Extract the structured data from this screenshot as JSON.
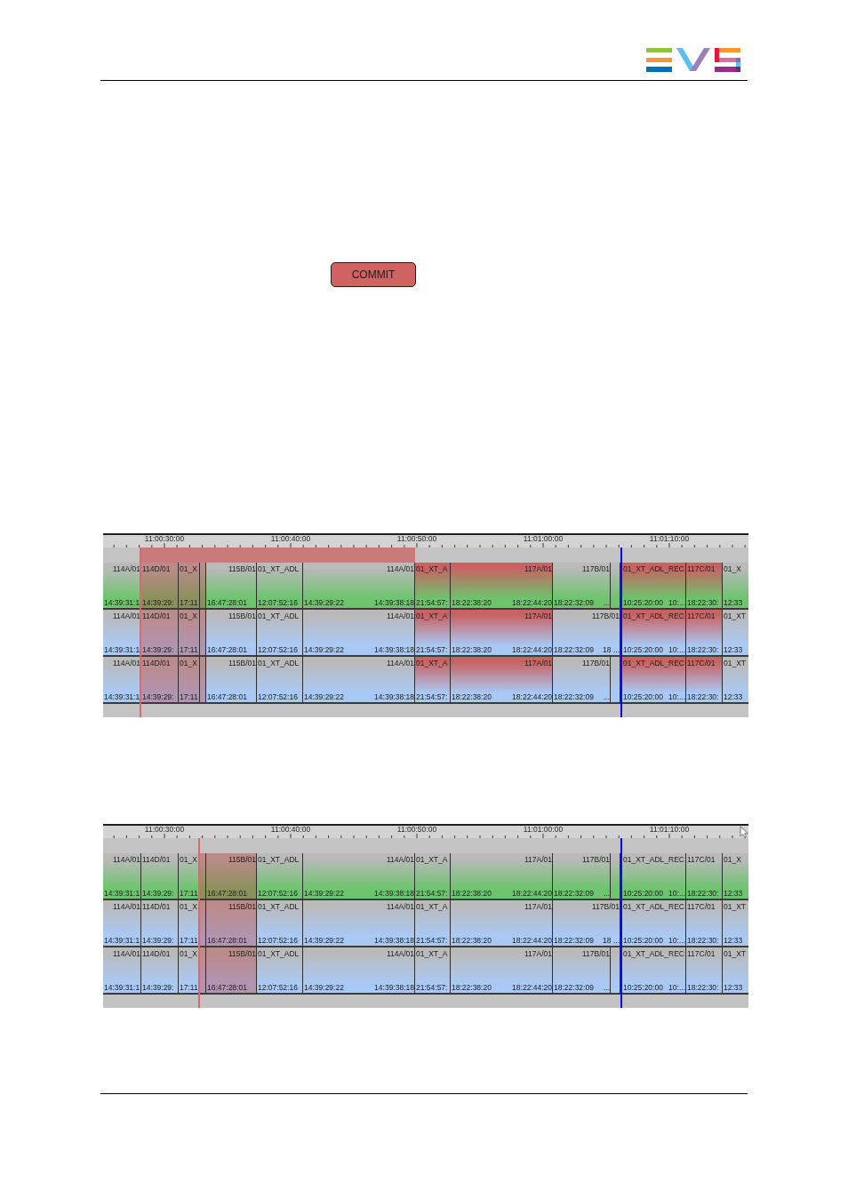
{
  "commit_button": {
    "label": "COMMIT"
  },
  "timelines": [
    {
      "ruler": [
        "11:00:30:00",
        "11:00:40:00",
        "11:00:50:00",
        "11:01:00:00",
        "11:01:10:00"
      ],
      "range_band": true,
      "cursor": false,
      "tracks": [
        {
          "color": "#6cc46c",
          "clips": [
            {
              "label": "114A/01",
              "start": "14:39:31:1",
              "selected": false,
              "marked": false
            },
            {
              "label": "114D/01",
              "start": "14:39:29:",
              "selected": false,
              "marked": true
            },
            {
              "label": "01_X",
              "start": "17:11",
              "selected": false,
              "marked": true
            },
            {
              "selected": false,
              "marked": true
            },
            {
              "label": "115B/01",
              "start": "16:47:28:01",
              "selected": false,
              "marked": false
            },
            {
              "label": "01_XT_ADL",
              "start": "12:07:52:16",
              "selected": false,
              "marked": false
            },
            {
              "label": "114A/01",
              "start": "14:39:29:22",
              "end": "14:39:38:18",
              "selected": false,
              "marked": false
            },
            {
              "label": "01_XT_A",
              "start": "21:54:57:",
              "selected": true,
              "marked": false
            },
            {
              "label": "117A/01",
              "start": "18:22:38:20",
              "end": "18:22:44:20",
              "selected": true,
              "marked": false
            },
            {
              "label": "117B/01",
              "start": "18:22:32:09",
              "end": "...",
              "selected": false,
              "marked": false
            },
            {
              "selected": false,
              "marked": false
            },
            {
              "label": "01_XT_ADL_REC",
              "start": "10:25:20:00",
              "end": "10:...",
              "selected": true,
              "marked": false
            },
            {
              "label": "117C/01",
              "start": "18:22:30:",
              "selected": true,
              "marked": false
            },
            {
              "label": "01_X",
              "start": "12:33",
              "selected": false,
              "marked": false
            }
          ]
        },
        {
          "color": "#a9c9f5",
          "clips": [
            {
              "label": "114A/01",
              "start": "14:39:31:1",
              "selected": false,
              "marked": false
            },
            {
              "label": "114D/01",
              "start": "14:39:29:",
              "selected": false,
              "marked": true
            },
            {
              "label": "01_X",
              "start": "17:11",
              "selected": false,
              "marked": true
            },
            {
              "selected": false,
              "marked": true
            },
            {
              "label": "115B/01",
              "start": "16:47:28:01",
              "selected": false,
              "marked": false
            },
            {
              "label": "01_XT_ADL",
              "start": "12:07:52:16",
              "selected": false,
              "marked": false
            },
            {
              "label": "114A/01",
              "start": "14:39:29:22",
              "end": "14:39:38:18",
              "selected": false,
              "marked": false
            },
            {
              "label": "01_XT_A",
              "start": "21:54:57:",
              "selected": true,
              "marked": false
            },
            {
              "label": "117A/01",
              "start": "18:22:38:20",
              "end": "18:22:44:20",
              "selected": true,
              "marked": false
            },
            {
              "label": "117B/01",
              "start": "18:22:32:09",
              "end": "18 ...",
              "selected": false,
              "marked": false
            },
            {
              "label": "01_XT_ADL_REC",
              "start": "10:25:20:00",
              "end": "10:...",
              "selected": true,
              "marked": false
            },
            {
              "label": "117C/01",
              "start": "18:22:30:",
              "selected": true,
              "marked": false
            },
            {
              "label": "01_XT",
              "start": "12:33",
              "selected": false,
              "marked": false
            }
          ]
        },
        {
          "color": "#a9c9f5",
          "clips": [
            {
              "label": "114A/01",
              "start": "14:39:31:1",
              "selected": false,
              "marked": false
            },
            {
              "label": "114D/01",
              "start": "14:39:29:",
              "selected": false,
              "marked": true
            },
            {
              "label": "01_X",
              "start": "17:11",
              "selected": false,
              "marked": true
            },
            {
              "selected": false,
              "marked": true
            },
            {
              "label": "115B/01",
              "start": "16:47:28:01",
              "selected": false,
              "marked": false
            },
            {
              "label": "01_XT_ADL",
              "start": "12:07:52:16",
              "selected": false,
              "marked": false
            },
            {
              "label": "114A/01",
              "start": "14:39:29:22",
              "end": "14:39:38:18",
              "selected": false,
              "marked": false
            },
            {
              "label": "01_XT_A",
              "start": "21:54:57:",
              "selected": true,
              "marked": false
            },
            {
              "label": "117A/01",
              "start": "18:22:38:20",
              "end": "18:22:44:20",
              "selected": true,
              "marked": false
            },
            {
              "label": "117B/01",
              "start": "18:22:32:09",
              "end": "...",
              "selected": false,
              "marked": false
            },
            {
              "selected": false,
              "marked": false
            },
            {
              "label": "01_XT_ADL_REC",
              "start": "10:25:20:00",
              "end": "10:...",
              "selected": true,
              "marked": false
            },
            {
              "label": "117C/01",
              "start": "18:22:30:",
              "selected": true,
              "marked": false
            },
            {
              "label": "01_XT",
              "start": "12:33",
              "selected": false,
              "marked": false
            }
          ]
        }
      ]
    },
    {
      "ruler": [
        "11:00:30:00",
        "11:00:40:00",
        "11:00:50:00",
        "11:01:00:00",
        "11:01:10:00"
      ],
      "range_band": false,
      "cursor": true,
      "tracks": [
        {
          "color": "#6cc46c",
          "clips": [
            {
              "label": "114A/01",
              "start": "14:39:31:1",
              "selected": false,
              "marked": false
            },
            {
              "label": "114D/01",
              "start": "14:39:29:",
              "selected": false,
              "marked": false
            },
            {
              "label": "01_X",
              "start": "17:11",
              "selected": false,
              "marked": false
            },
            {
              "selected": false,
              "marked": true
            },
            {
              "label": "115B/01",
              "start": "16:47:28:01",
              "selected": false,
              "marked": true
            },
            {
              "label": "01_XT_ADL",
              "start": "12:07:52:16",
              "selected": false,
              "marked": false
            },
            {
              "label": "114A/01",
              "start": "14:39:29:22",
              "end": "14:39:38:18",
              "selected": false,
              "marked": false
            },
            {
              "label": "01_XT_A",
              "start": "21:54:57:",
              "selected": false,
              "marked": false
            },
            {
              "label": "117A/01",
              "start": "18:22:38:20",
              "end": "18:22:44:20",
              "selected": false,
              "marked": false
            },
            {
              "label": "117B/01",
              "start": "18:22:32:09",
              "end": "...",
              "selected": false,
              "marked": false
            },
            {
              "selected": false,
              "marked": false
            },
            {
              "label": "01_XT_ADL_REC",
              "start": "10:25:20:00",
              "end": "10:...",
              "selected": false,
              "marked": false
            },
            {
              "label": "117C/01",
              "start": "18:22:30:",
              "selected": false,
              "marked": false
            },
            {
              "label": "01_X",
              "start": "12:33",
              "selected": false,
              "marked": false
            }
          ]
        },
        {
          "color": "#a9c9f5",
          "clips": [
            {
              "label": "114A/01",
              "start": "14:39:31:1",
              "selected": false,
              "marked": false
            },
            {
              "label": "114D/01",
              "start": "14:39:29:",
              "selected": false,
              "marked": false
            },
            {
              "label": "01_X",
              "start": "17:11",
              "selected": false,
              "marked": false
            },
            {
              "selected": false,
              "marked": true
            },
            {
              "label": "115B/01",
              "start": "16:47:28:01",
              "selected": false,
              "marked": true
            },
            {
              "label": "01_XT_ADL",
              "start": "12:07:52:16",
              "selected": false,
              "marked": false
            },
            {
              "label": "114A/01",
              "start": "14:39:29:22",
              "end": "14:39:38:18",
              "selected": false,
              "marked": false
            },
            {
              "label": "01_XT_A",
              "start": "21:54:57:",
              "selected": false,
              "marked": false
            },
            {
              "label": "117A/01",
              "start": "18:22:38:20",
              "end": "18:22:44:20",
              "selected": false,
              "marked": false
            },
            {
              "label": "117B/01",
              "start": "18:22:32:09",
              "end": "18 ...",
              "selected": false,
              "marked": false
            },
            {
              "label": "01_XT_ADL_REC",
              "start": "10:25:20:00",
              "end": "10:...",
              "selected": false,
              "marked": false
            },
            {
              "label": "117C/01",
              "start": "18:22:30:",
              "selected": false,
              "marked": false
            },
            {
              "label": "01_XT",
              "start": "12:33",
              "selected": false,
              "marked": false
            }
          ]
        },
        {
          "color": "#a9c9f5",
          "clips": [
            {
              "label": "114A/01",
              "start": "14:39:31:1",
              "selected": false,
              "marked": false
            },
            {
              "label": "114D/01",
              "start": "14:39:29:",
              "selected": false,
              "marked": false
            },
            {
              "label": "01_X",
              "start": "17:11",
              "selected": false,
              "marked": false
            },
            {
              "selected": false,
              "marked": true
            },
            {
              "label": "115B/01",
              "start": "16:47:28:01",
              "selected": false,
              "marked": true
            },
            {
              "label": "01_XT_ADL",
              "start": "12:07:52:16",
              "selected": false,
              "marked": false
            },
            {
              "label": "114A/01",
              "start": "14:39:29:22",
              "end": "14:39:38:18",
              "selected": false,
              "marked": false
            },
            {
              "label": "01_XT_A",
              "start": "21:54:57:",
              "selected": false,
              "marked": false
            },
            {
              "label": "117A/01",
              "start": "18:22:38:20",
              "end": "18:22:44:20",
              "selected": false,
              "marked": false
            },
            {
              "label": "117B/01",
              "start": "18:22:32:09",
              "end": "...",
              "selected": false,
              "marked": false
            },
            {
              "selected": false,
              "marked": false
            },
            {
              "label": "01_XT_ADL_REC",
              "start": "10:25:20:00",
              "end": "10:...",
              "selected": false,
              "marked": false
            },
            {
              "label": "117C/01",
              "start": "18:22:30:",
              "selected": false,
              "marked": false
            },
            {
              "label": "01_XT",
              "start": "12:33",
              "selected": false,
              "marked": false
            }
          ]
        }
      ]
    }
  ]
}
